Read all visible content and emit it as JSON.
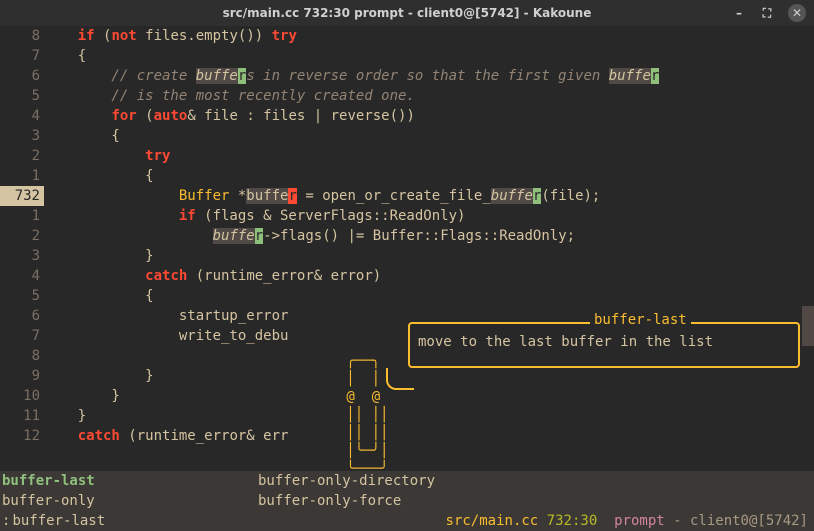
{
  "window": {
    "title": "src/main.cc 732:30  prompt - client0@[5742] - Kakoune"
  },
  "gutter": {
    "lines": [
      "8",
      "7",
      "6",
      "5",
      "4",
      "3",
      "2",
      "1",
      "732",
      "1",
      "2",
      "3",
      "4",
      "5",
      "6",
      "7",
      "8",
      "9",
      "10",
      "11",
      "12"
    ],
    "current_index": 8
  },
  "code": {
    "l0_kw1": "if",
    "l0_op1": " (",
    "l0_kw2": "not",
    "l0_id1": " files.",
    "l0_fn1": "empty",
    "l0_op2": "()) ",
    "l0_kw3": "try",
    "l1": "    {",
    "l2_cm1": "        // create ",
    "l2_hl1": "buffe",
    "l2_hlc1": "r",
    "l2_cm2": "s in reverse order so that the first given ",
    "l2_hl2": "buffe",
    "l2_hlc2": "r",
    "l3_cm": "        // is the most recently created one.",
    "l4_kw1": "for",
    "l4_op1": " (",
    "l4_kw2": "auto",
    "l4_op2": "& file : files | ",
    "l4_fn1": "reverse",
    "l4_op3": "())",
    "l5": "        {",
    "l6_kw": "try",
    "l7": "            {",
    "l8_ty": "Buffer",
    "l8_op1": " *",
    "l8_sel": "buffe",
    "l8_cur": "r",
    "l8_op2": " = ",
    "l8_fn": "open_or_create_file_",
    "l8_hl": "buffe",
    "l8_hlc": "r",
    "l8_op3": "(file);",
    "l9_kw": "if",
    "l9_op1": " (flags & ServerFlags::ReadOnly)",
    "l10_hl": "buffe",
    "l10_hlc": "r",
    "l10_op": "->",
    "l10_fn": "flags",
    "l10_rest": "() |= Buffer::Flags::ReadOnly;",
    "l11": "            }",
    "l12_kw": "catch",
    "l12_rest": " (runtime_error& error)",
    "l13": "            {",
    "l14": "                startup_error",
    "l15": "                write_to_debu",
    "l16": "",
    "l17": "            }",
    "l18": "        }",
    "l19": "    }",
    "l20_kw": "catch",
    "l20_rest": " (runtime_error& err"
  },
  "completion": {
    "rows": [
      [
        "buffer-last",
        "buffer-only-directory"
      ],
      [
        "buffer-only",
        "buffer-only-force"
      ]
    ],
    "selected": "buffer-last"
  },
  "status": {
    "prompt_prefix": ":",
    "prompt_text": "buffer-last",
    "cursor": " ",
    "file": "src/main.cc",
    "pos": "732:30",
    "mode": "prompt",
    "sep": " - ",
    "client": "client0@[5742]"
  },
  "tooltip": {
    "title": "buffer-last",
    "text": "move to the last buffer in the list",
    "clippy": " ╭──╮\n │  │\n @  @\n ││ ││\n ││ ││\n │╰─╯│\n ╰───╯"
  }
}
